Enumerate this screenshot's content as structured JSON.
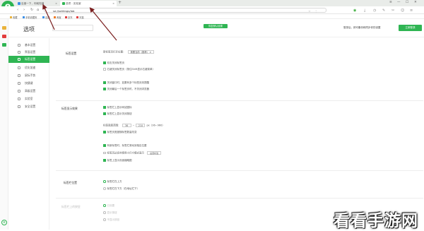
{
  "browser": {
    "logo_letter": "e",
    "tabs": [
      {
        "label": "百度一下，你就知道",
        "close": "×"
      },
      {
        "label": "选项 - 实验室",
        "close": "×"
      }
    ],
    "new_tab": "+",
    "window_controls": [
      "≡",
      "—",
      "☐",
      "✕"
    ],
    "nav": {
      "back": "‹",
      "forward": "›",
      "reload": "↻",
      "home": "⌂"
    },
    "address": "se://settings/lab",
    "addr_icons": "☆ ⋮",
    "bookmarks": [
      {
        "label": "收藏",
        "color": "#e9b23b"
      },
      {
        "label": "手机收藏夹",
        "color": "#3a8ee6"
      },
      {
        "label": "百度",
        "color": "#3a8ee6"
      },
      {
        "label": "淘宝",
        "color": "#f07a21"
      },
      {
        "label": "京东",
        "color": "#e23c3c"
      },
      {
        "label": "天猫",
        "color": "#e23c3c"
      }
    ],
    "bottom_icon": "e"
  },
  "settings": {
    "title": "选项",
    "search_placeholder": "",
    "restore_label": "恢复默认设置",
    "sync_text": "登录后，即可备份和同步你的设置",
    "login_label": "立即登录"
  },
  "sidebar": {
    "items": [
      {
        "label": "基本设置",
        "active": false
      },
      {
        "label": "界面设置",
        "active": false
      },
      {
        "label": "标签设置",
        "active": true
      },
      {
        "label": "优化加速",
        "active": false
      },
      {
        "label": "鼠标手势",
        "active": false
      },
      {
        "label": "快捷键",
        "active": false
      },
      {
        "label": "高级设置",
        "active": false
      },
      {
        "label": "实验室",
        "active": false
      },
      {
        "label": "安全设置",
        "active": false
      }
    ]
  },
  "content": {
    "sections": [
      {
        "title": "标签设置"
      },
      {
        "title": "标签显示效果"
      },
      {
        "title": "标签栏位置"
      },
      {
        "title": "标签栏上的按钮"
      }
    ],
    "tab_settings": {
      "open_label": "新标签页打开位置：",
      "open_select": "紧跟当前（推荐）",
      "opts1": [
        {
          "label": "双击关闭标签页",
          "on": true
        },
        {
          "label": "右键关闭标签页（按住Shift显示右键菜单）",
          "on": false
        }
      ],
      "opts2": [
        {
          "label": "关闭窗口时，如果有多个标签页则提醒",
          "on": true
        },
        {
          "label": "关闭最后一个标签页时，不关闭浏览器",
          "on": true
        }
      ]
    },
    "display": {
      "opts1": [
        {
          "label": "标签栏上显示网站图标",
          "on": true
        },
        {
          "label": "标签栏上显示关闭按钮",
          "on": true
        }
      ],
      "width_label": "标签宽度范围：",
      "width_min": "36",
      "width_max": "210",
      "width_unit": "px（36~960）",
      "auto_width": {
        "label": "标签页宽度随标签数量改变",
        "on": true
      },
      "opts2": [
        {
          "label": "有新标签时，标签栏滚动到相应位置",
          "on": true
        },
        {
          "label": "标签页过多时使用小尺寸模式显示",
          "on": false
        }
      ],
      "settings_btn": "设置标签",
      "opts3": [
        {
          "label": "标签上显示页面缩略图",
          "on": true
        }
      ]
    },
    "position": {
      "options": [
        {
          "label": "标签栏在上方",
          "on": true
        },
        {
          "label": "标签栏在下方（在地址栏下）",
          "on": false
        }
      ]
    },
    "buttons": {
      "options": [
        {
          "label": "已设置",
          "on": true
        },
        {
          "label": "显示按钮",
          "on": false
        },
        {
          "label": "不显示按钮",
          "on": false
        }
      ]
    }
  },
  "watermark": "看看手游网"
}
